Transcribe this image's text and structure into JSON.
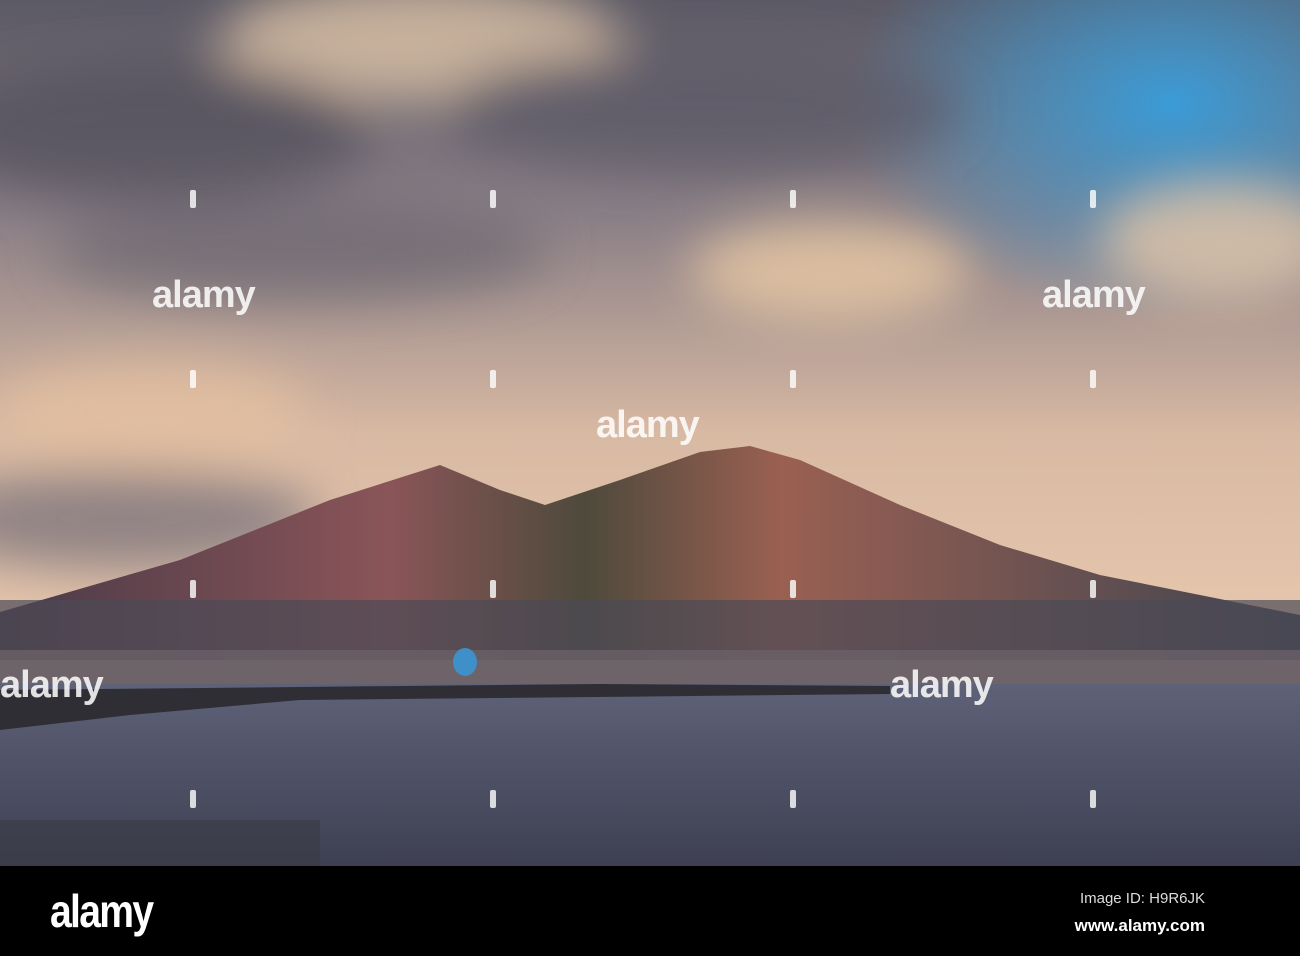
{
  "watermark": {
    "text": "alamy"
  },
  "footer": {
    "logo": "alamy",
    "image_id": "Image ID: H9R6JK",
    "website": "www.alamy.com"
  }
}
